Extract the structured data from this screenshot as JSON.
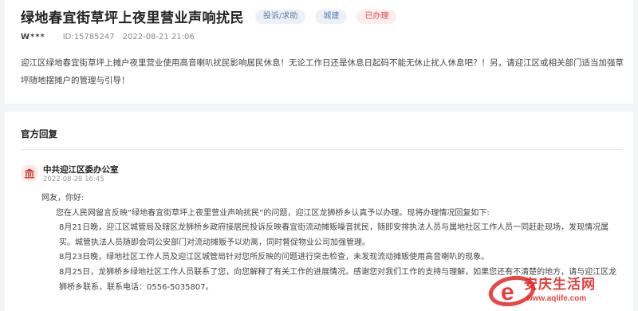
{
  "post": {
    "title": "绿地春宜街草坪上夜里营业声响扰民",
    "tags": {
      "type": "投诉/求助",
      "department": "城建",
      "status": "已办理"
    },
    "user": "W***",
    "id": "ID:15785247",
    "time": "2022-08-21 21:06",
    "content": "迎江区绿地春宜街草坪上摊户夜里营业使用高音喇叭扰民影响居民休息！无论工作日还是休息日起码不能无休止扰人休息吧？！另，请迎江区或相关部门适当加强草坪随地摆摊户的管理与引导！"
  },
  "reply_section": {
    "title": "官方回复",
    "org_name": "中共迎江区委办公室",
    "org_time": "2022-08-29 16:45",
    "paragraphs": {
      "greeting": "网友，你好:",
      "p1": "您在人民网留言反映“绿地春宜街草坪上夜里营业声响扰民”的问题，迎江区龙狮桥乡认真予以办理。现将办理情况回复如下:",
      "p2": "8月21日晚，迎江区城管局及辖区龙狮桥乡政府接居民投诉反映春宜街流动摊贩噪音扰民，随即安排执法人员与属地社区工作人员一同赶赴现场，发现情况属实。城管执法人员随即会同公安部门对流动摊贩予以劝离，同时督促物业公司加强管理。",
      "p3": "8月23日晚，绿地社区工作人员及迎江区城管局针对您所反映的问题进行突击检查，未发现流动摊贩使用高音喇叭的现象。",
      "p4": "8月25日，龙狮桥乡绿地社区工作人员联系了您，向您解释了有关工作的进展情况。感谢您对我们工作的支持与理解，如果您还有不清楚的地方，请与迎江区龙狮桥乡联系，联系电话：0556-5035807。"
    }
  },
  "watermark": {
    "text": "安庆生活网",
    "url": "www.aqlife.com"
  },
  "icons": {
    "org": "government-building-icon"
  },
  "colors": {
    "status_red": "#e04848",
    "tag_blue": "#4f7fb5",
    "watermark_red": "#e22828"
  }
}
